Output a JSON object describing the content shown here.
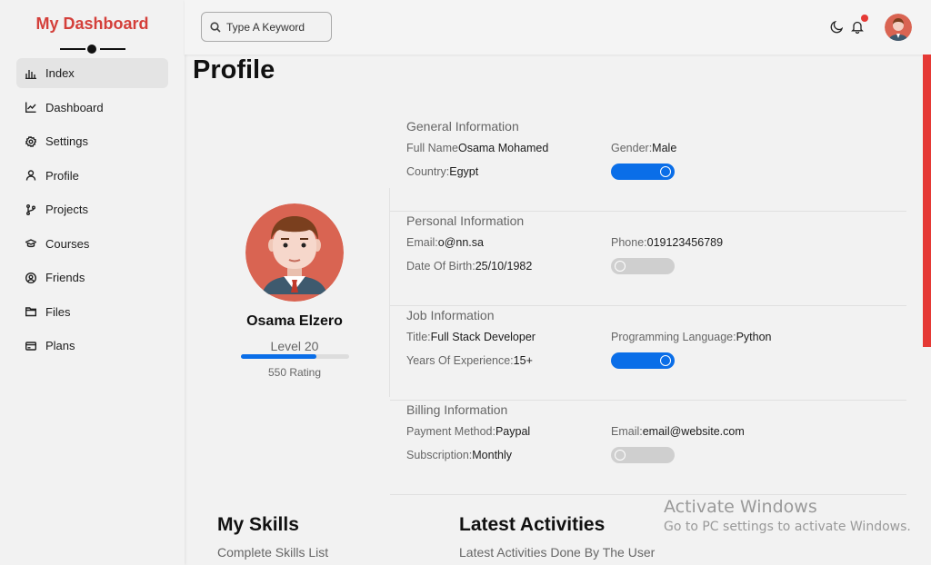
{
  "sidebar": {
    "logo": "My Dashboard",
    "items": [
      {
        "label": "Index",
        "icon": "bar-chart-icon"
      },
      {
        "label": "Dashboard",
        "icon": "line-chart-icon"
      },
      {
        "label": "Settings",
        "icon": "gear-icon"
      },
      {
        "label": "Profile",
        "icon": "user-icon"
      },
      {
        "label": "Projects",
        "icon": "branch-icon"
      },
      {
        "label": "Courses",
        "icon": "graduation-cap-icon"
      },
      {
        "label": "Friends",
        "icon": "friends-icon"
      },
      {
        "label": "Files",
        "icon": "folder-icon"
      },
      {
        "label": "Plans",
        "icon": "credit-card-icon"
      }
    ],
    "active_index": 0
  },
  "header": {
    "search_placeholder": "Type A Keyword"
  },
  "page": {
    "title": "Profile"
  },
  "profile": {
    "name": "Osama Elzero",
    "level": "Level 20",
    "level_progress": 0.7,
    "rating": "550 Rating"
  },
  "sections": [
    {
      "title": "General Information",
      "fields": [
        {
          "label": "Full Name",
          "value": "Osama Mohamed"
        },
        {
          "label": "Gender:",
          "value": "Male"
        },
        {
          "label": "Country:",
          "value": "Egypt"
        }
      ],
      "toggle_on": true
    },
    {
      "title": "Personal Information",
      "fields": [
        {
          "label": "Email:",
          "value": "o@nn.sa"
        },
        {
          "label": "Phone:",
          "value": "019123456789"
        },
        {
          "label": "Date Of Birth:",
          "value": "25/10/1982"
        }
      ],
      "toggle_on": false
    },
    {
      "title": "Job Information",
      "fields": [
        {
          "label": "Title:",
          "value": "Full Stack Developer"
        },
        {
          "label": "Programming Language:",
          "value": "Python"
        },
        {
          "label": "Years Of Experience:",
          "value": "15+"
        }
      ],
      "toggle_on": true
    },
    {
      "title": "Billing Information",
      "fields": [
        {
          "label": "Payment Method:",
          "value": "Paypal"
        },
        {
          "label": "Email:",
          "value": "email@website.com"
        },
        {
          "label": "Subscription:",
          "value": "Monthly"
        }
      ],
      "toggle_on": false
    }
  ],
  "widgets": {
    "skills": {
      "title": "My Skills",
      "subtitle": "Complete Skills List"
    },
    "activities": {
      "title": "Latest Activities",
      "subtitle": "Latest Activities Done By The User"
    }
  },
  "watermark": {
    "line1": "Activate Windows",
    "line2": "Go to PC settings to activate Windows."
  },
  "colors": {
    "accent": "#0a6ee8",
    "brand": "#d43f3a",
    "notification": "#e53935"
  }
}
